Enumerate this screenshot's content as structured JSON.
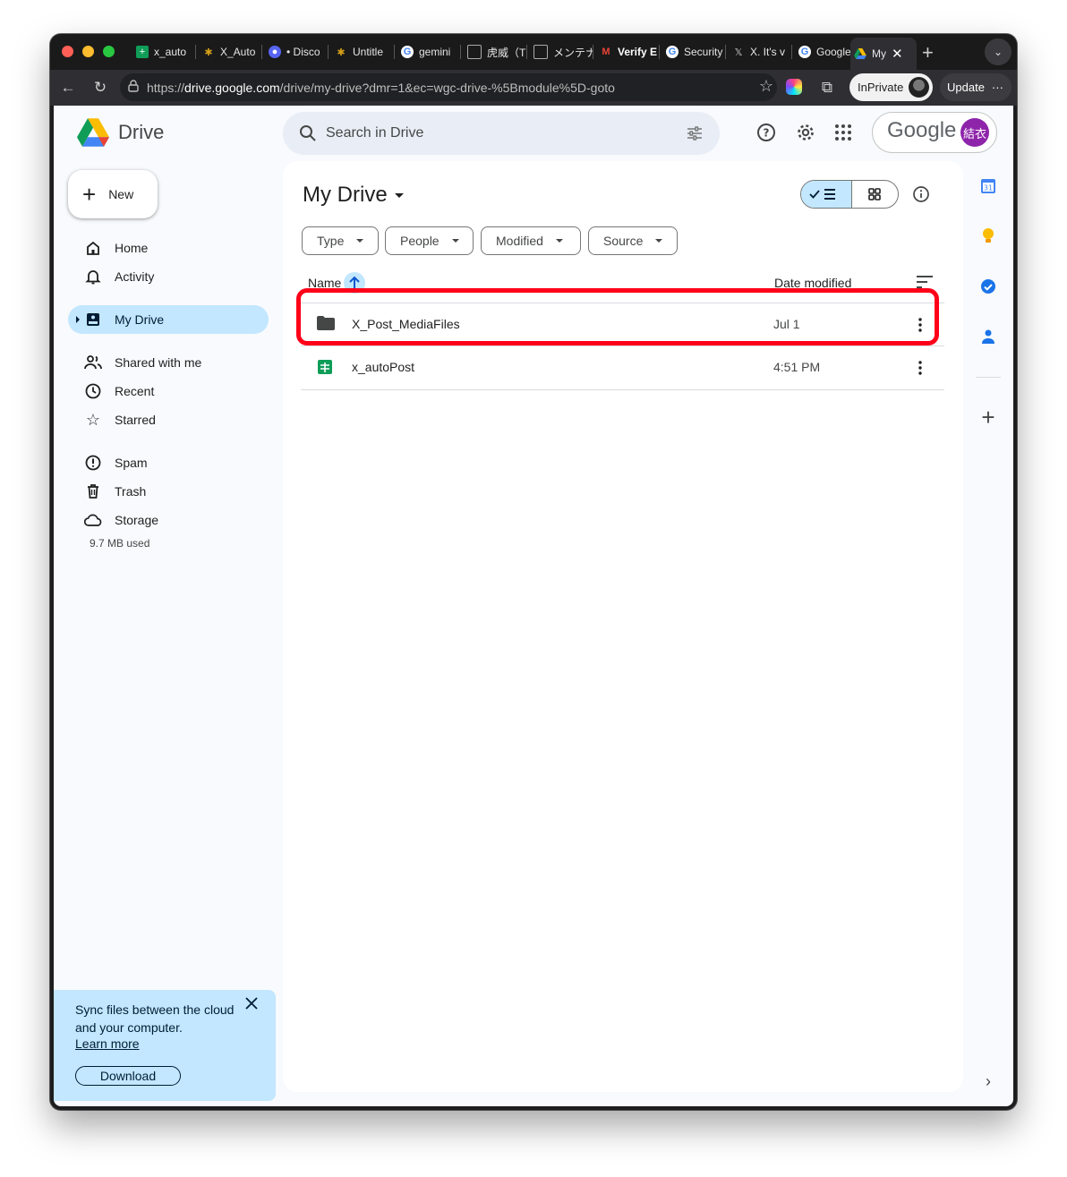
{
  "browser": {
    "tabs": [
      {
        "label": "x_auto",
        "icon": "sheets-icon"
      },
      {
        "label": "X_Auto",
        "icon": "palm-icon"
      },
      {
        "label": "• Disco",
        "icon": "discord-icon"
      },
      {
        "label": "Untitle",
        "icon": "palm-icon"
      },
      {
        "label": "gemini",
        "icon": "google-icon"
      },
      {
        "label": "虎威（T",
        "icon": "page-icon"
      },
      {
        "label": "メンテナ",
        "icon": "page-icon"
      },
      {
        "label": "Verify E",
        "icon": "gmail-icon"
      },
      {
        "label": "Security",
        "icon": "google-icon"
      },
      {
        "label": "X. It's v",
        "icon": "x-icon"
      },
      {
        "label": "Google",
        "icon": "google-icon"
      },
      {
        "label": "My",
        "icon": "drive-icon"
      }
    ],
    "url_prefix": "https://",
    "url_domain": "drive.google.com",
    "url_path": "/drive/my-drive?dmr=1&ec=wgc-drive-%5Bmodule%5D-goto",
    "inprivate_label": "InPrivate",
    "update_label": "Update"
  },
  "drive": {
    "app_name": "Drive",
    "search_placeholder": "Search in Drive",
    "account_brand": "Google",
    "account_initials": "結衣",
    "new_label": "New",
    "nav": {
      "home": "Home",
      "activity": "Activity",
      "my_drive": "My Drive",
      "shared": "Shared with me",
      "recent": "Recent",
      "starred": "Starred",
      "spam": "Spam",
      "trash": "Trash",
      "storage": "Storage"
    },
    "storage_used": "9.7 MB used",
    "sync_banner": {
      "text": "Sync files between the cloud and your computer.",
      "learn_more": "Learn more",
      "download": "Download"
    },
    "main": {
      "title": "My Drive",
      "filters": [
        "Type",
        "People",
        "Modified",
        "Source"
      ],
      "columns": {
        "name": "Name",
        "date": "Date modified"
      },
      "files": [
        {
          "name": "X_Post_MediaFiles",
          "date": "Jul 1",
          "kind": "folder"
        },
        {
          "name": "x_autoPost",
          "date": "4:51 PM",
          "kind": "sheet"
        }
      ]
    },
    "side_panel": {
      "calendar_day": "31"
    }
  },
  "colors": {
    "accent": "#c2e7ff",
    "highlight": "#ff0019",
    "sheets_green": "#0f9d58"
  }
}
